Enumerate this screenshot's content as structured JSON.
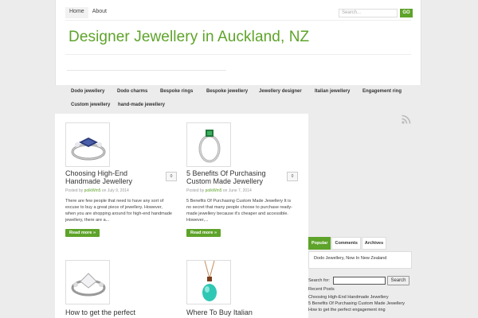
{
  "header": {
    "nav": [
      "Home",
      "About"
    ],
    "search_placeholder": "Search...",
    "go_label": "GO",
    "site_title": "Designer Jewellery in Auckland, NZ"
  },
  "categories": [
    "Dodo jewellery",
    "Dodo charms",
    "Bespoke rings",
    "Bespoke jewellery",
    "Jewellery designer",
    "Italian jewellery",
    "Engagement ring",
    "Custom jewellery",
    "hand-made jewellery"
  ],
  "posts": [
    {
      "title": "Choosing High-End Handmade Jewellery",
      "comments": "0",
      "posted_by": "Posted by",
      "author": "polkWm5",
      "on": "on July 9, 2014",
      "excerpt": "There are few people that need to have any sort of excuse to buy a great piece of jewellery. However, when you are shopping around for high-end handmade jewellery, there are a...",
      "read_more": "Read more »",
      "image": "ring-sapphire-image"
    },
    {
      "title": "5 Benefits Of Purchasing Custom Made Jewellery",
      "comments": "0",
      "posted_by": "Posted by",
      "author": "polkWm5",
      "on": "on June 7, 2014",
      "excerpt": "5 Benefits Of Purchasing Custom Made Jewellery It is no secret that many people choose to purchase ready-made jewellery because it's cheaper and accessible. However,...",
      "read_more": "Read more »",
      "image": "ring-emerald-image"
    },
    {
      "title": "How to get the perfect",
      "image": "ring-diamond-image"
    },
    {
      "title": "Where To Buy Italian",
      "image": "pendant-turquoise-image"
    }
  ],
  "sidebar": {
    "tabs": [
      "Popular",
      "Comments",
      "Archives"
    ],
    "popular_item": "Dodo Jewellery, Now In New Zealand",
    "search_label": "Search for:",
    "search_button": "Search",
    "recent_title": "Recent Posts",
    "recent": [
      "Choosing High-End Handmade Jewellery",
      "5 Benefits Of Purchasing Custom Made Jewellery",
      "How to get the perfect engagement ring"
    ]
  },
  "colors": {
    "accent": "#5ea32a",
    "background": "#ececec"
  }
}
